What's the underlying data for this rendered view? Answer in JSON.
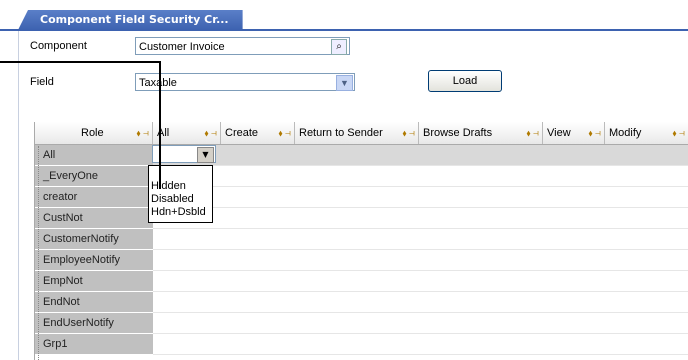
{
  "tab": {
    "label": "Component Field Security Cr..."
  },
  "form": {
    "component_label": "Component",
    "component_value": "Customer Invoice",
    "field_label": "Field",
    "field_value": "Taxable",
    "load_label": "Load"
  },
  "grid": {
    "columns": [
      "Role",
      "All",
      "Create",
      "Return to Sender",
      "Browse Drafts",
      "View",
      "Modify"
    ],
    "rows": [
      "All",
      "_EveryOne",
      "creator",
      "CustNot",
      "CustomerNotify",
      "EmployeeNotify",
      "EmpNot",
      "EndNot",
      "EndUserNotify",
      "Grp1"
    ]
  },
  "dropdown": {
    "options": [
      "Hidden",
      "Disabled",
      "Hdn+Dsbld"
    ]
  },
  "icons": {
    "lookup": "magnifier-icon",
    "dropdown": "chevron-down-icon",
    "column_tools": "pin-icon"
  }
}
